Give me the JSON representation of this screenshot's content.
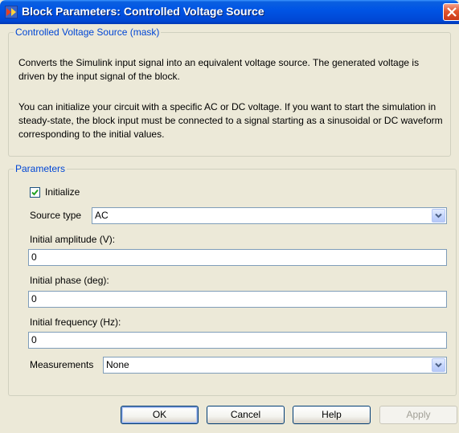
{
  "window": {
    "title": "Block Parameters: Controlled Voltage Source",
    "icon": "simulink-block-icon",
    "close_icon": "close-icon"
  },
  "mask_group": {
    "legend": "Controlled Voltage Source (mask)",
    "description_1": "Converts the Simulink input signal into an equivalent voltage source. The generated voltage is driven by the input signal of the block.",
    "description_2": "You can initialize your circuit with a specific AC or DC voltage. If you want to start the simulation in steady-state, the block input must be connected to a signal starting as a sinusoidal or DC waveform corresponding to the initial values."
  },
  "params_group": {
    "legend": "Parameters",
    "initialize": {
      "label": "Initialize",
      "checked": true
    },
    "source_type": {
      "label": "Source type",
      "value": "AC"
    },
    "initial_amplitude": {
      "label": "Initial amplitude (V):",
      "value": "0"
    },
    "initial_phase": {
      "label": "Initial phase (deg):",
      "value": "0"
    },
    "initial_frequency": {
      "label": "Initial frequency (Hz):",
      "value": "0"
    },
    "measurements": {
      "label": "Measurements",
      "value": "None"
    }
  },
  "buttons": {
    "ok": "OK",
    "cancel": "Cancel",
    "help": "Help",
    "apply": "Apply"
  },
  "colors": {
    "titlebar": "#0055e5",
    "dialog_bg": "#ece9d8",
    "group_legend": "#0046d5",
    "close_button": "#e2552d"
  }
}
